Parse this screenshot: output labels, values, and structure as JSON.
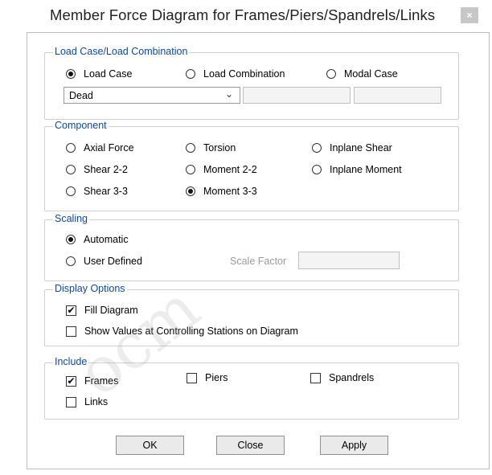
{
  "window": {
    "title": "Member Force Diagram for Frames/Piers/Spandrels/Links",
    "close_glyph": "×"
  },
  "load": {
    "legend": "Load Case/Load Combination",
    "options": [
      {
        "label": "Load Case",
        "selected": true
      },
      {
        "label": "Load Combination",
        "selected": false
      },
      {
        "label": "Modal Case",
        "selected": false
      }
    ],
    "case_value": "Dead"
  },
  "component": {
    "legend": "Component",
    "options": [
      {
        "label": "Axial Force",
        "selected": false
      },
      {
        "label": "Torsion",
        "selected": false
      },
      {
        "label": "Inplane Shear",
        "selected": false
      },
      {
        "label": "Shear 2-2",
        "selected": false
      },
      {
        "label": "Moment 2-2",
        "selected": false
      },
      {
        "label": "Inplane Moment",
        "selected": false
      },
      {
        "label": "Shear 3-3",
        "selected": false
      },
      {
        "label": "Moment 3-3",
        "selected": true
      }
    ]
  },
  "scaling": {
    "legend": "Scaling",
    "options": [
      {
        "label": "Automatic",
        "selected": true
      },
      {
        "label": "User Defined",
        "selected": false
      }
    ],
    "scale_factor_label": "Scale Factor",
    "scale_factor_value": ""
  },
  "display": {
    "legend": "Display Options",
    "options": [
      {
        "label": "Fill Diagram",
        "checked": true
      },
      {
        "label": "Show Values at Controlling Stations on Diagram",
        "checked": false
      }
    ]
  },
  "include": {
    "legend": "Include",
    "options": [
      {
        "label": "Frames",
        "checked": true
      },
      {
        "label": "Piers",
        "checked": false
      },
      {
        "label": "Spandrels",
        "checked": false
      },
      {
        "label": "Links",
        "checked": false
      }
    ]
  },
  "buttons": {
    "ok": "OK",
    "close": "Close",
    "apply": "Apply"
  },
  "watermark": "ocm",
  "colors": {
    "legend": "#0a47b5",
    "close_button": "#c7c7c7"
  }
}
